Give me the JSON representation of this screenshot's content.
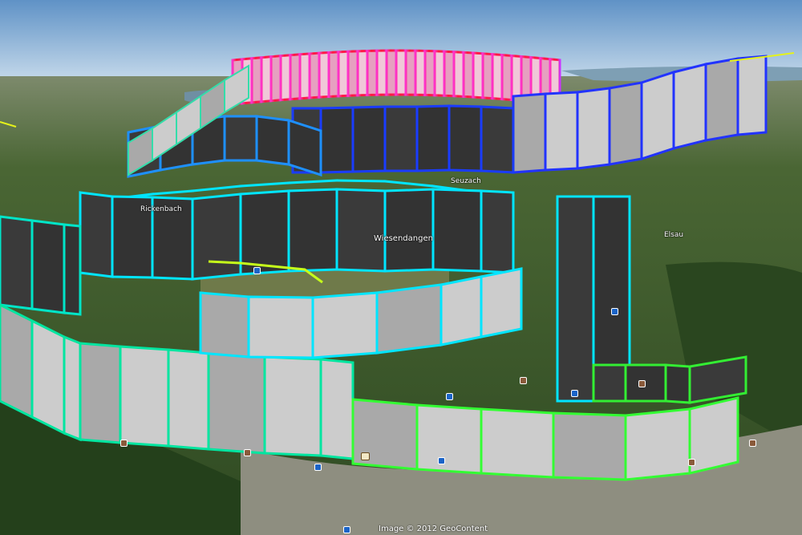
{
  "map": {
    "view": "3D satellite terrain with extruded flight track curtain",
    "places": [
      {
        "name": "Rickenbach"
      },
      {
        "name": "Wiesendangen"
      },
      {
        "name": "Elsau"
      },
      {
        "name": "Seuzach"
      }
    ],
    "credit": "Image © 2012 GeoContent",
    "colors": {
      "sky_top": "#6b98c8",
      "sky_horizon": "#c9dbea",
      "terrain": "#3e5a2e",
      "track_low": "#33ff33",
      "track_mid": "#00e5ff",
      "track_high_blue": "#1a3cff",
      "track_top": "#ff1a4a",
      "track_magenta": "#ff33cc",
      "curtain_light": "#cccccc",
      "curtain_dark": "#333333"
    }
  }
}
